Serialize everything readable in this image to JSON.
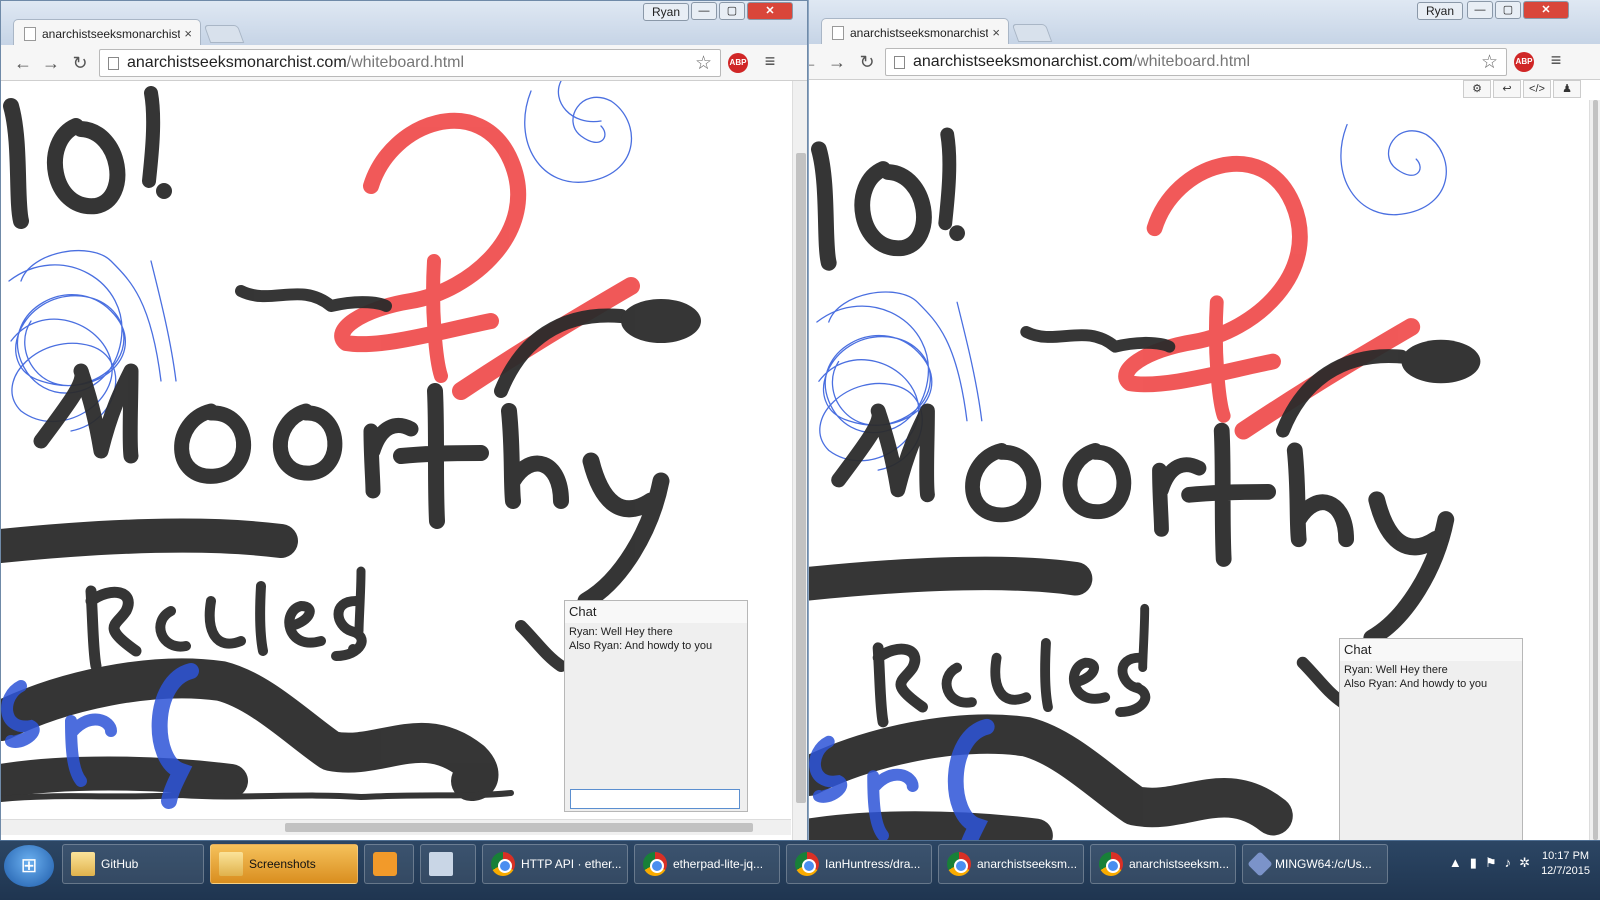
{
  "browser": {
    "tab_title": "anarchistseeksmonarchist.com",
    "tab_close": "×",
    "profile": "Ryan",
    "url_host": "anarchistseeksmonarchist.com",
    "url_path": "/whiteboard.html",
    "back": "←",
    "forward": "→",
    "reload": "↻",
    "star": "☆",
    "abp": "ABP",
    "menu": "≡",
    "minimize": "—",
    "maximize": "▢",
    "close": "✕"
  },
  "whiteboard": {
    "tools": [
      "⚙",
      "↩",
      "</>",
      "♟"
    ],
    "handwritten_text": [
      "o!",
      "Moorthy",
      "Rules!",
      "er?"
    ],
    "stroke_colors": {
      "black": "#2b2b2b",
      "red": "#f05050",
      "blue": "#4a6fe0",
      "blue_dark": "#2d54d8"
    }
  },
  "chat": {
    "title": "Chat",
    "messages": [
      "Ryan: Well Hey there",
      "Also Ryan: And howdy to you"
    ],
    "input_value": ""
  },
  "taskbar": {
    "start_icon": "⊞",
    "items": [
      {
        "label": "GitHub",
        "icon": "folder-icon"
      },
      {
        "label": "Screenshots",
        "icon": "folder-icon",
        "active": true
      },
      {
        "label": "",
        "icon": "media-icon"
      },
      {
        "label": "",
        "icon": "calc-icon"
      },
      {
        "label": "HTTP API · ether...",
        "icon": "chrome-icon"
      },
      {
        "label": "etherpad-lite-jq...",
        "icon": "chrome-icon"
      },
      {
        "label": "IanHuntress/dra...",
        "icon": "chrome-icon"
      },
      {
        "label": "anarchistseeksm...",
        "icon": "chrome-icon"
      },
      {
        "label": "anarchistseeksm...",
        "icon": "chrome-icon"
      },
      {
        "label": "MINGW64:/c/Us...",
        "icon": "git-icon"
      }
    ],
    "clock_time": "10:17 PM",
    "clock_date": "12/7/2015"
  }
}
